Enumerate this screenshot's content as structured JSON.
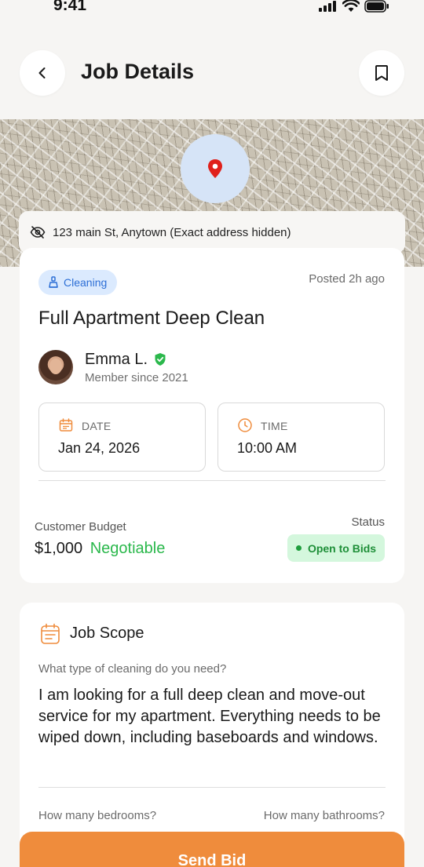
{
  "status_bar": {
    "time": "9:41",
    "icons": [
      "signal-icon",
      "wifi-icon",
      "battery-icon"
    ]
  },
  "header": {
    "title": "Job Details",
    "back_icon": "chevron-left-icon",
    "bookmark_icon": "bookmark-icon"
  },
  "map": {
    "pin_icon": "map-pin-icon",
    "pin_color": "#e0201b",
    "address": "123 main St, Anytown (Exact address hidden)",
    "address_icon": "eye-off-icon"
  },
  "job": {
    "category": "Cleaning",
    "category_icon": "cleaning-icon",
    "posted": "Posted 2h ago",
    "title": "Full Apartment Deep Clean",
    "customer": {
      "name": "Emma L.",
      "verified_icon": "verified-shield-icon",
      "member_since": "Member since 2021"
    },
    "date_label": "DATE",
    "date_value": "Jan 24, 2026",
    "date_icon": "calendar-icon",
    "time_label": "TIME",
    "time_value": "10:00 AM",
    "time_icon": "clock-icon",
    "budget_label": "Customer Budget",
    "budget_amount": "$1,000",
    "budget_negotiable": "Negotiable",
    "status_label": "Status",
    "status_value": "Open to Bids"
  },
  "scope": {
    "title": "Job Scope",
    "icon": "calendar-list-icon",
    "question": "What type of cleaning do you need?",
    "answer": "I am looking for a full deep clean and move-out service for my apartment. Everything needs to be wiped down, including baseboards and windows.",
    "bedrooms_question": "How many bedrooms?",
    "bathrooms_question": "How many bathrooms?"
  },
  "actions": {
    "send_bid": "Send Bid"
  },
  "colors": {
    "accent": "#ef8c3c",
    "badge_bg": "#dbeafe",
    "badge_text": "#2d6fd6",
    "status_bg": "#d4f7dd",
    "status_text": "#1e8f38",
    "negotiable": "#2bb84c"
  }
}
